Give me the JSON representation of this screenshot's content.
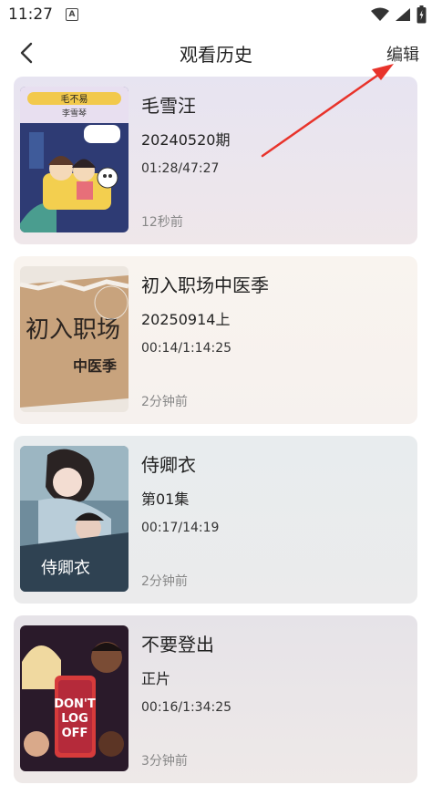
{
  "status_bar": {
    "time": "11:27",
    "notification_icon_letter": "A",
    "icons": [
      "wifi-icon",
      "signal-icon",
      "battery-icon"
    ]
  },
  "header": {
    "back_icon": "chevron-left-icon",
    "title": "观看历史",
    "edit_label": "编辑"
  },
  "history": [
    {
      "title": "毛雪汪",
      "episode": "20240520期",
      "progress": "01:28/47:27",
      "watched": "12秒前",
      "poster_text": [
        "毛不易",
        "李雪琴"
      ],
      "card_bg": "#ebe6f0"
    },
    {
      "title": "初入职场中医季",
      "episode": "20250914上",
      "progress": "00:14/1:14:25",
      "watched": "2分钟前",
      "poster_text": [
        "初入职场",
        "中医季"
      ],
      "card_bg": "#f8f2ec"
    },
    {
      "title": "侍卿衣",
      "episode": "第01集",
      "progress": "00:17/14:19",
      "watched": "2分钟前",
      "poster_text": [
        "侍卿衣"
      ],
      "card_bg": "#ebeced"
    },
    {
      "title": "不要登出",
      "episode": "正片",
      "progress": "00:16/1:34:25",
      "watched": "3分钟前",
      "poster_text": [
        "DON'T",
        "LOG",
        "OFF"
      ],
      "card_bg": "#ece8e9"
    }
  ],
  "colors": {
    "annotation_arrow": "#e8332b"
  }
}
